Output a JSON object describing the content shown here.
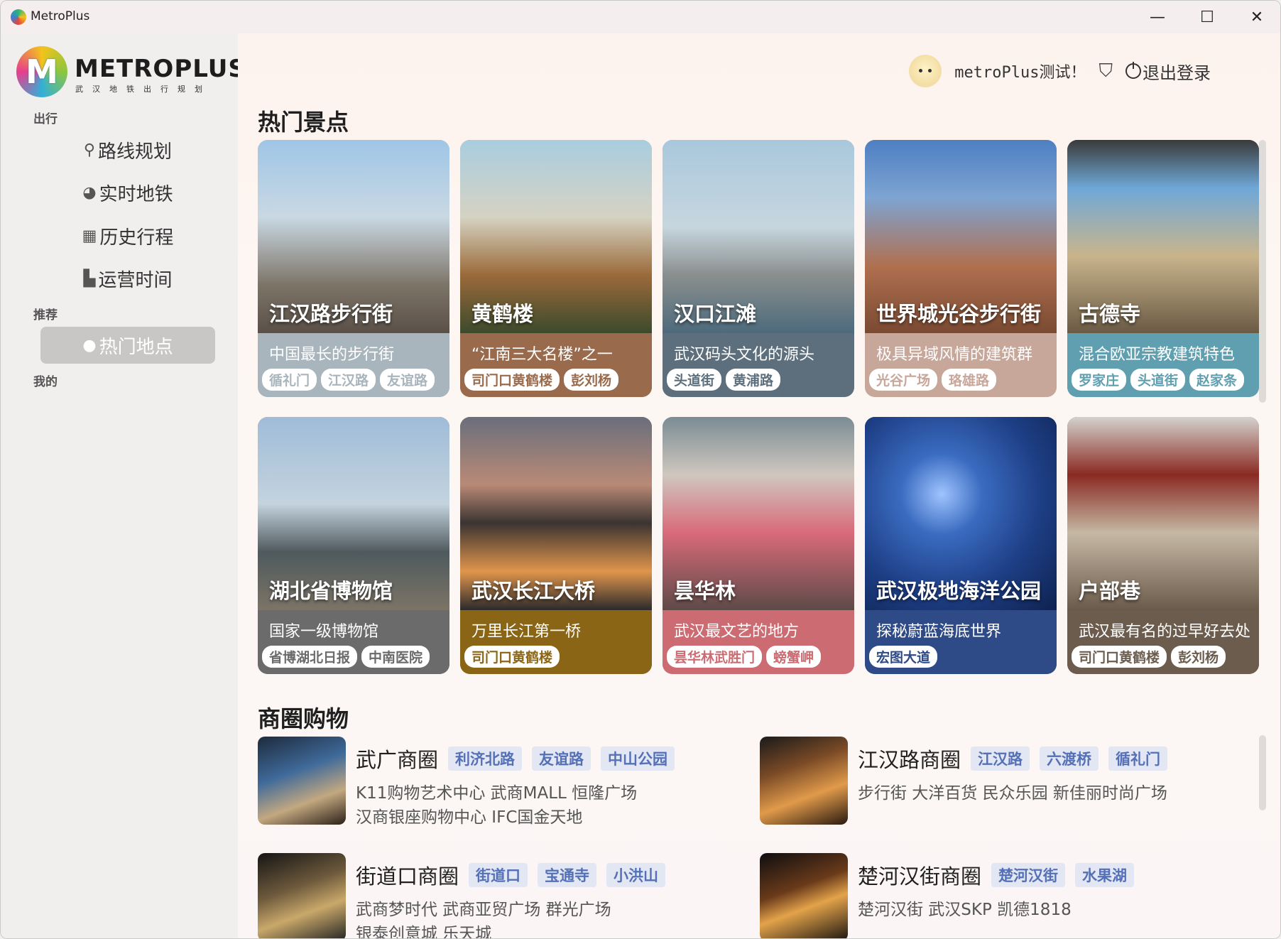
{
  "window": {
    "title": "MetroPlus",
    "minimize": "—",
    "maximize": "☐",
    "close": "✕"
  },
  "logo": {
    "mark": "M",
    "name": "METROPLUS",
    "sub": "武汉地铁出行规划"
  },
  "sidebar": {
    "sections": [
      {
        "label": "出行"
      },
      {
        "label": "推荐"
      },
      {
        "label": "我的"
      }
    ],
    "items": [
      {
        "label": "路线规划",
        "icon": "location-pin-icon",
        "glyph": "📍"
      },
      {
        "label": "实时地铁",
        "icon": "clock-icon",
        "glyph": "◕"
      },
      {
        "label": "历史行程",
        "icon": "calendar-icon",
        "glyph": "▦"
      },
      {
        "label": "运营时间",
        "icon": "document-icon",
        "glyph": "▙"
      },
      {
        "label": "热门地点",
        "icon": "fire-icon",
        "glyph": "●"
      }
    ]
  },
  "header": {
    "user_name": "metroPlus测试！",
    "logout_label": "退出登录",
    "shirt_glyph": "👕"
  },
  "hot_spots": {
    "title": "热门景点",
    "cards": [
      {
        "name": "江汉路步行街",
        "desc": "中国最长的步行街",
        "tags": [
          "循礼门",
          "江汉路",
          "友谊路"
        ],
        "panel": "#a9b5bd",
        "tag_color": "#a9b5bd",
        "img": "linear-gradient(180deg,#9fc6e6 0%,#c9d8e3 40%,#7d7468 75%,#5a5048 100%)"
      },
      {
        "name": "黄鹤楼",
        "desc": "“江南三大名楼”之一",
        "tags": [
          "司门口黄鹤楼",
          "彭刘杨"
        ],
        "panel": "#9a6a4c",
        "tag_color": "#9a6a4c",
        "img": "linear-gradient(180deg,#a9cde0 0%,#d5d3c2 40%,#9b6a3a 70%,#3c4a2c 100%)"
      },
      {
        "name": "汉口江滩",
        "desc": "武汉码头文化的源头",
        "tags": [
          "头道街",
          "黄浦路"
        ],
        "panel": "#5d6f7d",
        "tag_color": "#5d6f7d",
        "img": "linear-gradient(180deg,#a9c8dd 0%,#c7d6de 45%,#8a8f8e 70%,#4d6a7c 100%)"
      },
      {
        "name": "世界城光谷步行街",
        "desc": "极具异域风情的建筑群",
        "tags": [
          "光谷广场",
          "珞雄路"
        ],
        "panel": "#c8a79b",
        "tag_color": "#c8a79b",
        "img": "linear-gradient(180deg,#4d7fc2 0%,#7ea4d2 30%,#b07050 65%,#7a4a32 100%)"
      },
      {
        "name": "古德寺",
        "desc": "混合欧亚宗教建筑特色",
        "tags": [
          "罗家庄",
          "头道街",
          "赵家条"
        ],
        "panel": "#5f9fb0",
        "tag_color": "#5f9fb0",
        "img": "linear-gradient(180deg,#3a3a3a 0%,#6fa8d8 25%,#c9b48c 60%,#6a5a44 100%)"
      },
      {
        "name": "湖北省博物馆",
        "desc": "国家一级博物馆",
        "tags": [
          "省博湖北日报",
          "中南医院"
        ],
        "panel": "#6b6b6b",
        "tag_color": "#6b6b6b",
        "img": "linear-gradient(180deg,#9fbcd8 0%,#c4d3de 45%,#4f5a5e 70%,#7c7466 100%)"
      },
      {
        "name": "武汉长江大桥",
        "desc": "万里长江第一桥",
        "tags": [
          "司门口黄鹤楼"
        ],
        "panel": "#8a6516",
        "tag_color": "#8a6516",
        "img": "linear-gradient(180deg,#6a6e7c 0%,#b98a76 35%,#3b3431 55%,#e0954c 80%,#2b2a2c 100%)"
      },
      {
        "name": "昙华林",
        "desc": "武汉最文艺的地方",
        "tags": [
          "昙华林武胜门",
          "螃蟹岬"
        ],
        "panel": "#cc6c72",
        "tag_color": "#cc6c72",
        "img": "linear-gradient(180deg,#7a8c94 0%,#cfc7bf 30%,#d96a7a 60%,#5e4a48 100%)"
      },
      {
        "name": "武汉极地海洋公园",
        "desc": "探秘蔚蓝海底世界",
        "tags": [
          "宏图大道"
        ],
        "panel": "#2e4b87",
        "tag_color": "#2e4b87",
        "img": "radial-gradient(circle at 40% 40%,#9fc4ff 0%,#3a6bc0 25%,#1e3f86 60%,#0e2250 100%)"
      },
      {
        "name": "户部巷",
        "desc": "武汉最有名的过早好去处",
        "tags": [
          "司门口黄鹤楼",
          "彭刘杨"
        ],
        "panel": "#6b5c4e",
        "tag_color": "#6b5c4e",
        "img": "linear-gradient(180deg,#d4d2ce 0%,#8a2a22 30%,#c5b8a4 60%,#6a5a4a 100%)"
      }
    ]
  },
  "malls": {
    "title": "商圈购物",
    "items": [
      {
        "name": "武广商圈",
        "tags": [
          "利济北路",
          "友谊路",
          "中山公园"
        ],
        "lines": [
          "K11购物艺术中心 武商MALL 恒隆广场",
          "汉商银座购物中心 IFC国金天地"
        ],
        "img": "linear-gradient(160deg,#1d2a3c 0%,#3f6a9a 40%,#c3a880 70%,#2b2018 100%)"
      },
      {
        "name": "江汉路商圈",
        "tags": [
          "江汉路",
          "六渡桥",
          "循礼门"
        ],
        "lines": [
          "步行街 大洋百货 民众乐园 新佳丽时尚广场"
        ],
        "img": "linear-gradient(160deg,#1a1a1a 0%,#7a4a26 35%,#e09a4a 65%,#2a1a10 100%)"
      },
      {
        "name": "街道口商圈",
        "tags": [
          "街道口",
          "宝通寺",
          "小洪山"
        ],
        "lines": [
          "武商梦时代 武商亚贸广场 群光广场",
          "银泰创意城 乐天城"
        ],
        "img": "linear-gradient(160deg,#151515 0%,#6e5a3c 40%,#c9a86a 65%,#222 100%)"
      },
      {
        "name": "楚河汉街商圈",
        "tags": [
          "楚河汉街",
          "水果湖"
        ],
        "lines": [
          "楚河汉街 武汉SKP 凯德1818"
        ],
        "img": "linear-gradient(160deg,#0e0e10 0%,#6a3a1a 40%,#e3a34a 60%,#1a1410 100%)"
      }
    ]
  }
}
